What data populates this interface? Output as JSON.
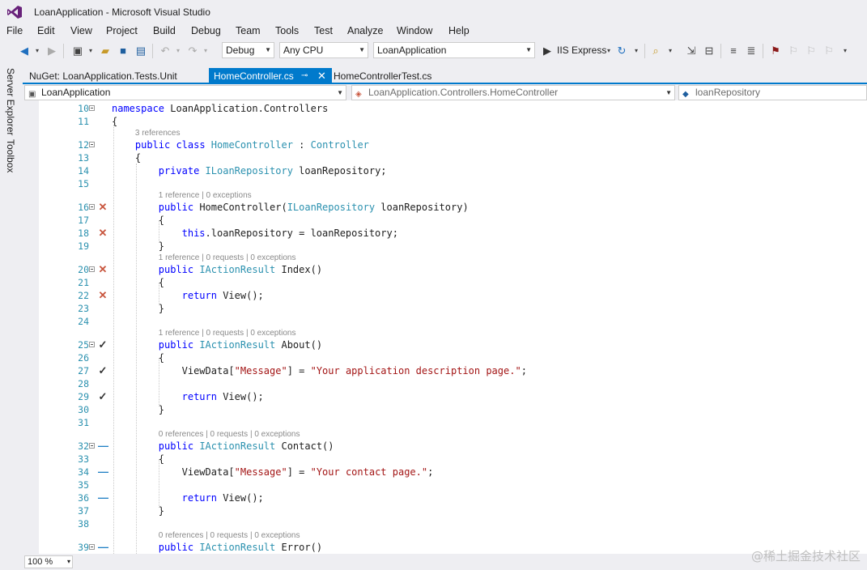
{
  "window": {
    "title": "LoanApplication - Microsoft Visual Studio"
  },
  "menu": [
    "File",
    "Edit",
    "View",
    "Project",
    "Build",
    "Debug",
    "Team",
    "Tools",
    "Test",
    "Analyze",
    "Window",
    "Help"
  ],
  "toolbar": {
    "config": "Debug",
    "platform": "Any CPU",
    "startup_project": "LoanApplication",
    "run_label": "IIS Express"
  },
  "side": {
    "server_explorer": "Server Explorer",
    "toolbox": "Toolbox"
  },
  "tabs": [
    {
      "label": "NuGet: LoanApplication.Tests.Unit"
    },
    {
      "label": "HomeController.cs",
      "active": true
    },
    {
      "label": "HomeControllerTest.cs"
    }
  ],
  "nav": {
    "project": "LoanApplication",
    "type": "LoanApplication.Controllers.HomeController",
    "member": "loanRepository"
  },
  "code": {
    "lines": [
      {
        "n": "10",
        "fold": true
      },
      {
        "n": "11"
      },
      {
        "lens": "3 references"
      },
      {
        "n": "12",
        "fold": true
      },
      {
        "n": "13"
      },
      {
        "n": "14"
      },
      {
        "n": "15"
      },
      {
        "lens": "1 reference | 0 exceptions"
      },
      {
        "n": "16",
        "fold": true,
        "mark": "x"
      },
      {
        "n": "17"
      },
      {
        "n": "18",
        "mark": "x"
      },
      {
        "n": "19"
      },
      {
        "lens": "1 reference | 0 requests | 0 exceptions"
      },
      {
        "n": "20",
        "fold": true,
        "mark": "x"
      },
      {
        "n": "21"
      },
      {
        "n": "22",
        "mark": "x"
      },
      {
        "n": "23"
      },
      {
        "n": "24"
      },
      {
        "lens": "1 reference | 0 requests | 0 exceptions"
      },
      {
        "n": "25",
        "fold": true,
        "mark": "check"
      },
      {
        "n": "26"
      },
      {
        "n": "27",
        "mark": "check"
      },
      {
        "n": "28"
      },
      {
        "n": "29",
        "mark": "check"
      },
      {
        "n": "30"
      },
      {
        "n": "31"
      },
      {
        "lens": "0 references | 0 requests | 0 exceptions"
      },
      {
        "n": "32",
        "fold": true,
        "mark": "dash"
      },
      {
        "n": "33"
      },
      {
        "n": "34",
        "mark": "dash"
      },
      {
        "n": "35"
      },
      {
        "n": "36",
        "mark": "dash"
      },
      {
        "n": "37"
      },
      {
        "n": "38"
      },
      {
        "lens": "0 references | 0 requests | 0 exceptions"
      },
      {
        "n": "39",
        "fold": true,
        "mark": "dash"
      }
    ],
    "text": {
      "l10": [
        "namespace",
        " LoanApplication.Controllers"
      ],
      "l11": "{",
      "l12": [
        "public class ",
        "HomeController",
        " : ",
        "Controller"
      ],
      "l13": "{",
      "l14": [
        "private ",
        "ILoanRepository",
        " loanRepository;"
      ],
      "l16": [
        "public ",
        "HomeController(",
        "ILoanRepository",
        " loanRepository)"
      ],
      "l17": "{",
      "l18": [
        "this",
        ".loanRepository = loanRepository;"
      ],
      "l19": "}",
      "l20": [
        "public ",
        "IActionResult",
        " Index()"
      ],
      "l21": "{",
      "l22": [
        "return",
        " View();"
      ],
      "l23": "}",
      "l25": [
        "public ",
        "IActionResult",
        " About()"
      ],
      "l26": "{",
      "l27": [
        "ViewData[",
        "\"Message\"",
        "] = ",
        "\"Your application description page.\"",
        ";"
      ],
      "l29": [
        "return",
        " View();"
      ],
      "l30": "}",
      "l32": [
        "public ",
        "IActionResult",
        " Contact()"
      ],
      "l33": "{",
      "l34": [
        "ViewData[",
        "\"Message\"",
        "] = ",
        "\"Your contact page.\"",
        ";"
      ],
      "l36": [
        "return",
        " View();"
      ],
      "l37": "}",
      "l39": [
        "public ",
        "IActionResult",
        " Error()"
      ]
    }
  },
  "status": {
    "zoom": "100 %"
  },
  "watermark": "@稀土掘金技术社区"
}
